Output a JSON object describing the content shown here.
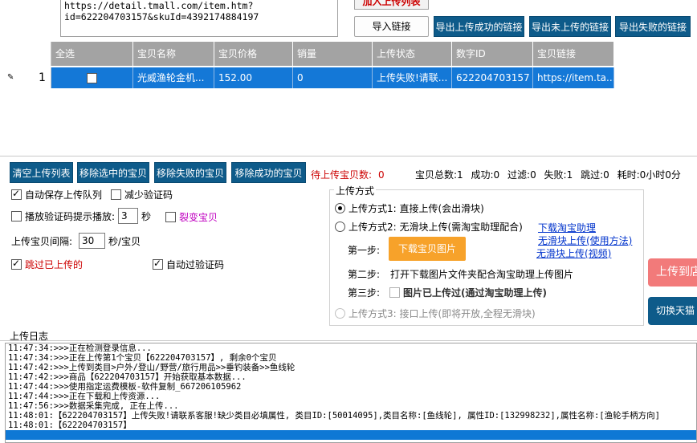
{
  "top": {
    "url_text": "https://detail.tmall.com/item.htm?\nid=622204703157&skuId=4392174884197",
    "add_list_label": "加入上传列表",
    "import_label": "导入链接",
    "export_success_label": "导出上传成功的链接",
    "export_not_uploaded_label": "导出未上传的链接",
    "export_failed_label": "导出失败的链接"
  },
  "table": {
    "headers": [
      "",
      "全选",
      "宝贝名称",
      "宝贝价格",
      "销量",
      "上传状态",
      "数字ID",
      "宝贝链接"
    ],
    "rows": [
      {
        "num": "1",
        "name": "光威渔轮金机...",
        "price": "152.00",
        "sales": "0",
        "status": "上传失败!请联...",
        "id": "622204703157",
        "link": "https://item.ta..."
      }
    ]
  },
  "controls": {
    "clear_label": "清空上传列表",
    "remove_selected_label": "移除选中的宝贝",
    "remove_failed_label": "移除失败的宝贝",
    "remove_success_label": "移除成功的宝贝",
    "pending_label": "待上传宝贝数:",
    "pending_value": "0",
    "stats": {
      "total": "宝贝总数:1",
      "success": "成功:0",
      "filtered": "过滤:0",
      "failed": "失败:1",
      "skipped": "跳过:0",
      "elapsed": "耗时:0小时0分"
    },
    "auto_save_label": "自动保存上传队列",
    "reduce_captcha_label": "减少验证码",
    "play_captcha_label": "播放验证码提示播放:",
    "play_captcha_value": "3",
    "seconds_label": "秒",
    "fission_label": "裂变宝贝",
    "interval_label": "上传宝贝间隔:",
    "interval_value": "30",
    "interval_unit": "秒/宝贝",
    "skip_uploaded_label": "跳过已上传的",
    "auto_captcha_label": "自动过验证码"
  },
  "method": {
    "title": "上传方式",
    "m1": "上传方式1: 直接上传(会出滑块)",
    "m2": "上传方式2: 无滑块上传(需淘宝助理配合)",
    "link_download": "下载淘宝助理",
    "link_usage": "无滑块上传(使用方法)",
    "link_video": "无滑块上传(视频)",
    "step1": "第一步:",
    "download_images": "下载宝贝图片",
    "step2": "第二步:",
    "step2_text": "打开下载图片文件夹配合淘宝助理上传图片",
    "step3": "第三步:",
    "step3_text": "图片已上传过(通过淘宝助理上传)",
    "m3": "上传方式3: 接口上传(即将开放,全程无滑块)"
  },
  "right": {
    "upload_label": "上传到店",
    "switch_label": "切换天猫"
  },
  "log": {
    "title": "上传日志",
    "lines": [
      "11:47:34:>>>正在检测登录信息...",
      "11:47:34:>>>正在上传第1个宝贝【622204703157】, 剩余0个宝贝",
      "11:47:42:>>>上传到类目>户外/登山/野营/旅行用品>>垂钓装备>>鱼线轮",
      "11:47:42:>>>商品【622204703157】开始获取基本数据...",
      "11:47:44:>>>使用指定运费模板-软件复制_667206105962",
      "11:47:44:>>>正在下载和上传资源...",
      "11:47:56:>>>数据采集完成, 正在上传...",
      "11:48:01:【622204703157】上传失败!请联系客服!缺少类目必填属性, 类目ID:[50014095],类目名称:[鱼线轮], 属性ID:[132998232],属性名称:[渔轮手柄方向]",
      "11:48:01:【622204703157】"
    ]
  },
  "colors": {
    "accent_blue": "#0e5b8a",
    "row_selected": "#1478d7",
    "orange": "#f7a22a",
    "red_text": "#cc0000"
  }
}
